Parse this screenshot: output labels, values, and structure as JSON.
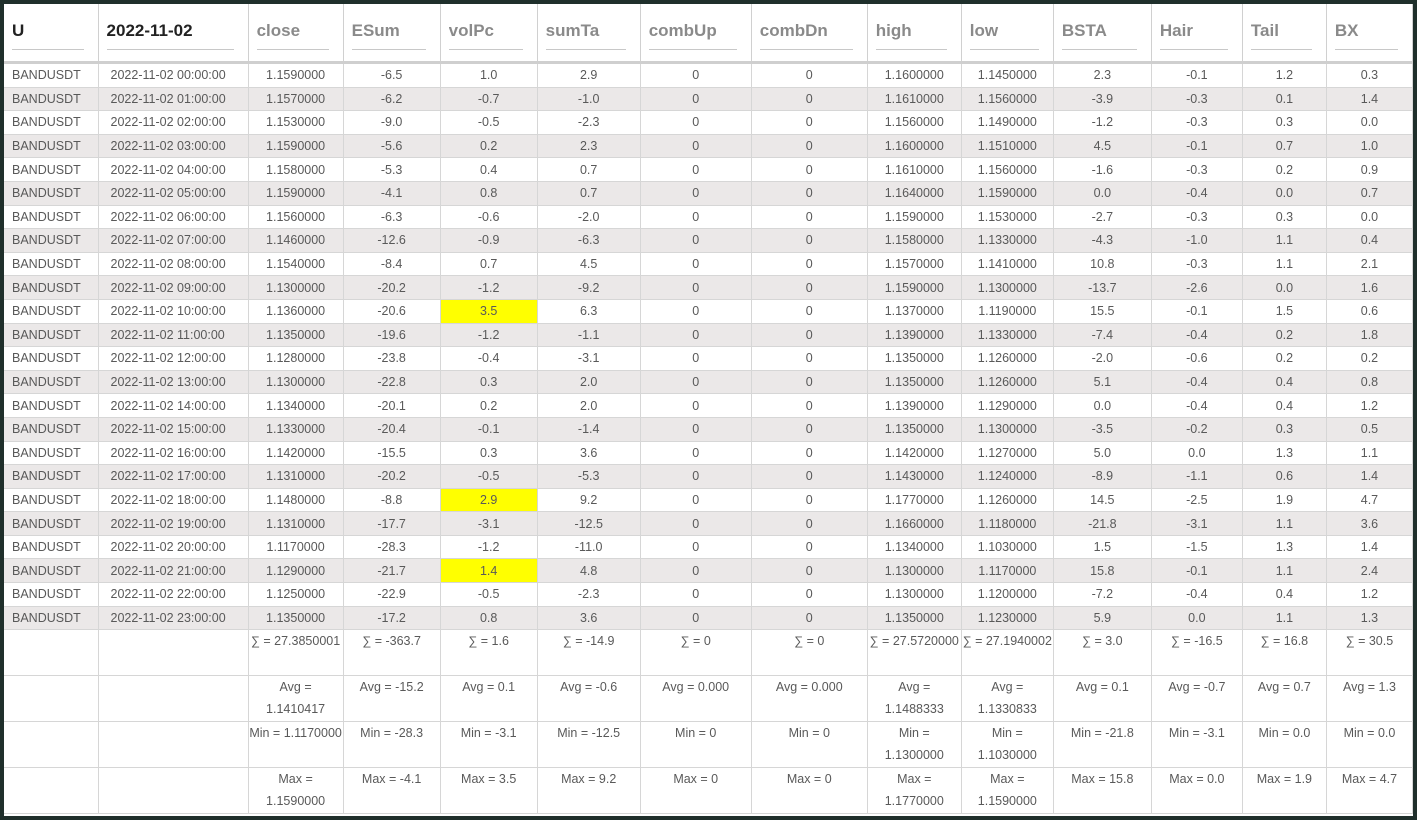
{
  "headers": [
    "U",
    "2022-11-02",
    "close",
    "ESum",
    "volPc",
    "sumTa",
    "combUp",
    "combDn",
    "high",
    "low",
    "BSTA",
    "Hair",
    "Tail",
    "BX"
  ],
  "highlight_color": "#ffff00",
  "rows": [
    [
      "BANDUSDT",
      "2022-11-02 00:00:00",
      "1.1590000",
      "-6.5",
      "1.0",
      "2.9",
      "0",
      "0",
      "1.1600000",
      "1.1450000",
      "2.3",
      "-0.1",
      "1.2",
      "0.3"
    ],
    [
      "BANDUSDT",
      "2022-11-02 01:00:00",
      "1.1570000",
      "-6.2",
      "-0.7",
      "-1.0",
      "0",
      "0",
      "1.1610000",
      "1.1560000",
      "-3.9",
      "-0.3",
      "0.1",
      "1.4"
    ],
    [
      "BANDUSDT",
      "2022-11-02 02:00:00",
      "1.1530000",
      "-9.0",
      "-0.5",
      "-2.3",
      "0",
      "0",
      "1.1560000",
      "1.1490000",
      "-1.2",
      "-0.3",
      "0.3",
      "0.0"
    ],
    [
      "BANDUSDT",
      "2022-11-02 03:00:00",
      "1.1590000",
      "-5.6",
      "0.2",
      "2.3",
      "0",
      "0",
      "1.1600000",
      "1.1510000",
      "4.5",
      "-0.1",
      "0.7",
      "1.0"
    ],
    [
      "BANDUSDT",
      "2022-11-02 04:00:00",
      "1.1580000",
      "-5.3",
      "0.4",
      "0.7",
      "0",
      "0",
      "1.1610000",
      "1.1560000",
      "-1.6",
      "-0.3",
      "0.2",
      "0.9"
    ],
    [
      "BANDUSDT",
      "2022-11-02 05:00:00",
      "1.1590000",
      "-4.1",
      "0.8",
      "0.7",
      "0",
      "0",
      "1.1640000",
      "1.1590000",
      "0.0",
      "-0.4",
      "0.0",
      "0.7"
    ],
    [
      "BANDUSDT",
      "2022-11-02 06:00:00",
      "1.1560000",
      "-6.3",
      "-0.6",
      "-2.0",
      "0",
      "0",
      "1.1590000",
      "1.1530000",
      "-2.7",
      "-0.3",
      "0.3",
      "0.0"
    ],
    [
      "BANDUSDT",
      "2022-11-02 07:00:00",
      "1.1460000",
      "-12.6",
      "-0.9",
      "-6.3",
      "0",
      "0",
      "1.1580000",
      "1.1330000",
      "-4.3",
      "-1.0",
      "1.1",
      "0.4"
    ],
    [
      "BANDUSDT",
      "2022-11-02 08:00:00",
      "1.1540000",
      "-8.4",
      "0.7",
      "4.5",
      "0",
      "0",
      "1.1570000",
      "1.1410000",
      "10.8",
      "-0.3",
      "1.1",
      "2.1"
    ],
    [
      "BANDUSDT",
      "2022-11-02 09:00:00",
      "1.1300000",
      "-20.2",
      "-1.2",
      "-9.2",
      "0",
      "0",
      "1.1590000",
      "1.1300000",
      "-13.7",
      "-2.6",
      "0.0",
      "1.6"
    ],
    [
      "BANDUSDT",
      "2022-11-02 10:00:00",
      "1.1360000",
      "-20.6",
      "3.5",
      "6.3",
      "0",
      "0",
      "1.1370000",
      "1.1190000",
      "15.5",
      "-0.1",
      "1.5",
      "0.6"
    ],
    [
      "BANDUSDT",
      "2022-11-02 11:00:00",
      "1.1350000",
      "-19.6",
      "-1.2",
      "-1.1",
      "0",
      "0",
      "1.1390000",
      "1.1330000",
      "-7.4",
      "-0.4",
      "0.2",
      "1.8"
    ],
    [
      "BANDUSDT",
      "2022-11-02 12:00:00",
      "1.1280000",
      "-23.8",
      "-0.4",
      "-3.1",
      "0",
      "0",
      "1.1350000",
      "1.1260000",
      "-2.0",
      "-0.6",
      "0.2",
      "0.2"
    ],
    [
      "BANDUSDT",
      "2022-11-02 13:00:00",
      "1.1300000",
      "-22.8",
      "0.3",
      "2.0",
      "0",
      "0",
      "1.1350000",
      "1.1260000",
      "5.1",
      "-0.4",
      "0.4",
      "0.8"
    ],
    [
      "BANDUSDT",
      "2022-11-02 14:00:00",
      "1.1340000",
      "-20.1",
      "0.2",
      "2.0",
      "0",
      "0",
      "1.1390000",
      "1.1290000",
      "0.0",
      "-0.4",
      "0.4",
      "1.2"
    ],
    [
      "BANDUSDT",
      "2022-11-02 15:00:00",
      "1.1330000",
      "-20.4",
      "-0.1",
      "-1.4",
      "0",
      "0",
      "1.1350000",
      "1.1300000",
      "-3.5",
      "-0.2",
      "0.3",
      "0.5"
    ],
    [
      "BANDUSDT",
      "2022-11-02 16:00:00",
      "1.1420000",
      "-15.5",
      "0.3",
      "3.6",
      "0",
      "0",
      "1.1420000",
      "1.1270000",
      "5.0",
      "0.0",
      "1.3",
      "1.1"
    ],
    [
      "BANDUSDT",
      "2022-11-02 17:00:00",
      "1.1310000",
      "-20.2",
      "-0.5",
      "-5.3",
      "0",
      "0",
      "1.1430000",
      "1.1240000",
      "-8.9",
      "-1.1",
      "0.6",
      "1.4"
    ],
    [
      "BANDUSDT",
      "2022-11-02 18:00:00",
      "1.1480000",
      "-8.8",
      "2.9",
      "9.2",
      "0",
      "0",
      "1.1770000",
      "1.1260000",
      "14.5",
      "-2.5",
      "1.9",
      "4.7"
    ],
    [
      "BANDUSDT",
      "2022-11-02 19:00:00",
      "1.1310000",
      "-17.7",
      "-3.1",
      "-12.5",
      "0",
      "0",
      "1.1660000",
      "1.1180000",
      "-21.8",
      "-3.1",
      "1.1",
      "3.6"
    ],
    [
      "BANDUSDT",
      "2022-11-02 20:00:00",
      "1.1170000",
      "-28.3",
      "-1.2",
      "-11.0",
      "0",
      "0",
      "1.1340000",
      "1.1030000",
      "1.5",
      "-1.5",
      "1.3",
      "1.4"
    ],
    [
      "BANDUSDT",
      "2022-11-02 21:00:00",
      "1.1290000",
      "-21.7",
      "1.4",
      "4.8",
      "0",
      "0",
      "1.1300000",
      "1.1170000",
      "15.8",
      "-0.1",
      "1.1",
      "2.4"
    ],
    [
      "BANDUSDT",
      "2022-11-02 22:00:00",
      "1.1250000",
      "-22.9",
      "-0.5",
      "-2.3",
      "0",
      "0",
      "1.1300000",
      "1.1200000",
      "-7.2",
      "-0.4",
      "0.4",
      "1.2"
    ],
    [
      "BANDUSDT",
      "2022-11-02 23:00:00",
      "1.1350000",
      "-17.2",
      "0.8",
      "3.6",
      "0",
      "0",
      "1.1350000",
      "1.1230000",
      "5.9",
      "0.0",
      "1.1",
      "1.3"
    ]
  ],
  "highlights": [
    {
      "row": 10,
      "col": 4
    },
    {
      "row": 18,
      "col": 4
    },
    {
      "row": 21,
      "col": 4
    }
  ],
  "stats": [
    [
      "",
      "",
      "∑ = 27.3850001",
      "∑ = -363.7",
      "∑ = 1.6",
      "∑ = -14.9",
      "∑ = 0",
      "∑ = 0",
      "∑ = 27.5720000",
      "∑ = 27.1940002",
      "∑ = 3.0",
      "∑ = -16.5",
      "∑ = 16.8",
      "∑ = 30.5"
    ],
    [
      "",
      "",
      "Avg = 1.1410417",
      "Avg = -15.2",
      "Avg = 0.1",
      "Avg = -0.6",
      "Avg = 0.000",
      "Avg = 0.000",
      "Avg = 1.1488333",
      "Avg = 1.1330833",
      "Avg = 0.1",
      "Avg = -0.7",
      "Avg = 0.7",
      "Avg = 1.3"
    ],
    [
      "",
      "",
      "Min = 1.1170000",
      "Min = -28.3",
      "Min = -3.1",
      "Min = -12.5",
      "Min = 0",
      "Min = 0",
      "Min = 1.1300000",
      "Min = 1.1030000",
      "Min = -21.8",
      "Min = -3.1",
      "Min = 0.0",
      "Min = 0.0"
    ],
    [
      "",
      "",
      "Max = 1.1590000",
      "Max = -4.1",
      "Max = 3.5",
      "Max = 9.2",
      "Max = 0",
      "Max = 0",
      "Max = 1.1770000",
      "Max = 1.1590000",
      "Max = 15.8",
      "Max = 0.0",
      "Max = 1.9",
      "Max = 4.7"
    ]
  ]
}
